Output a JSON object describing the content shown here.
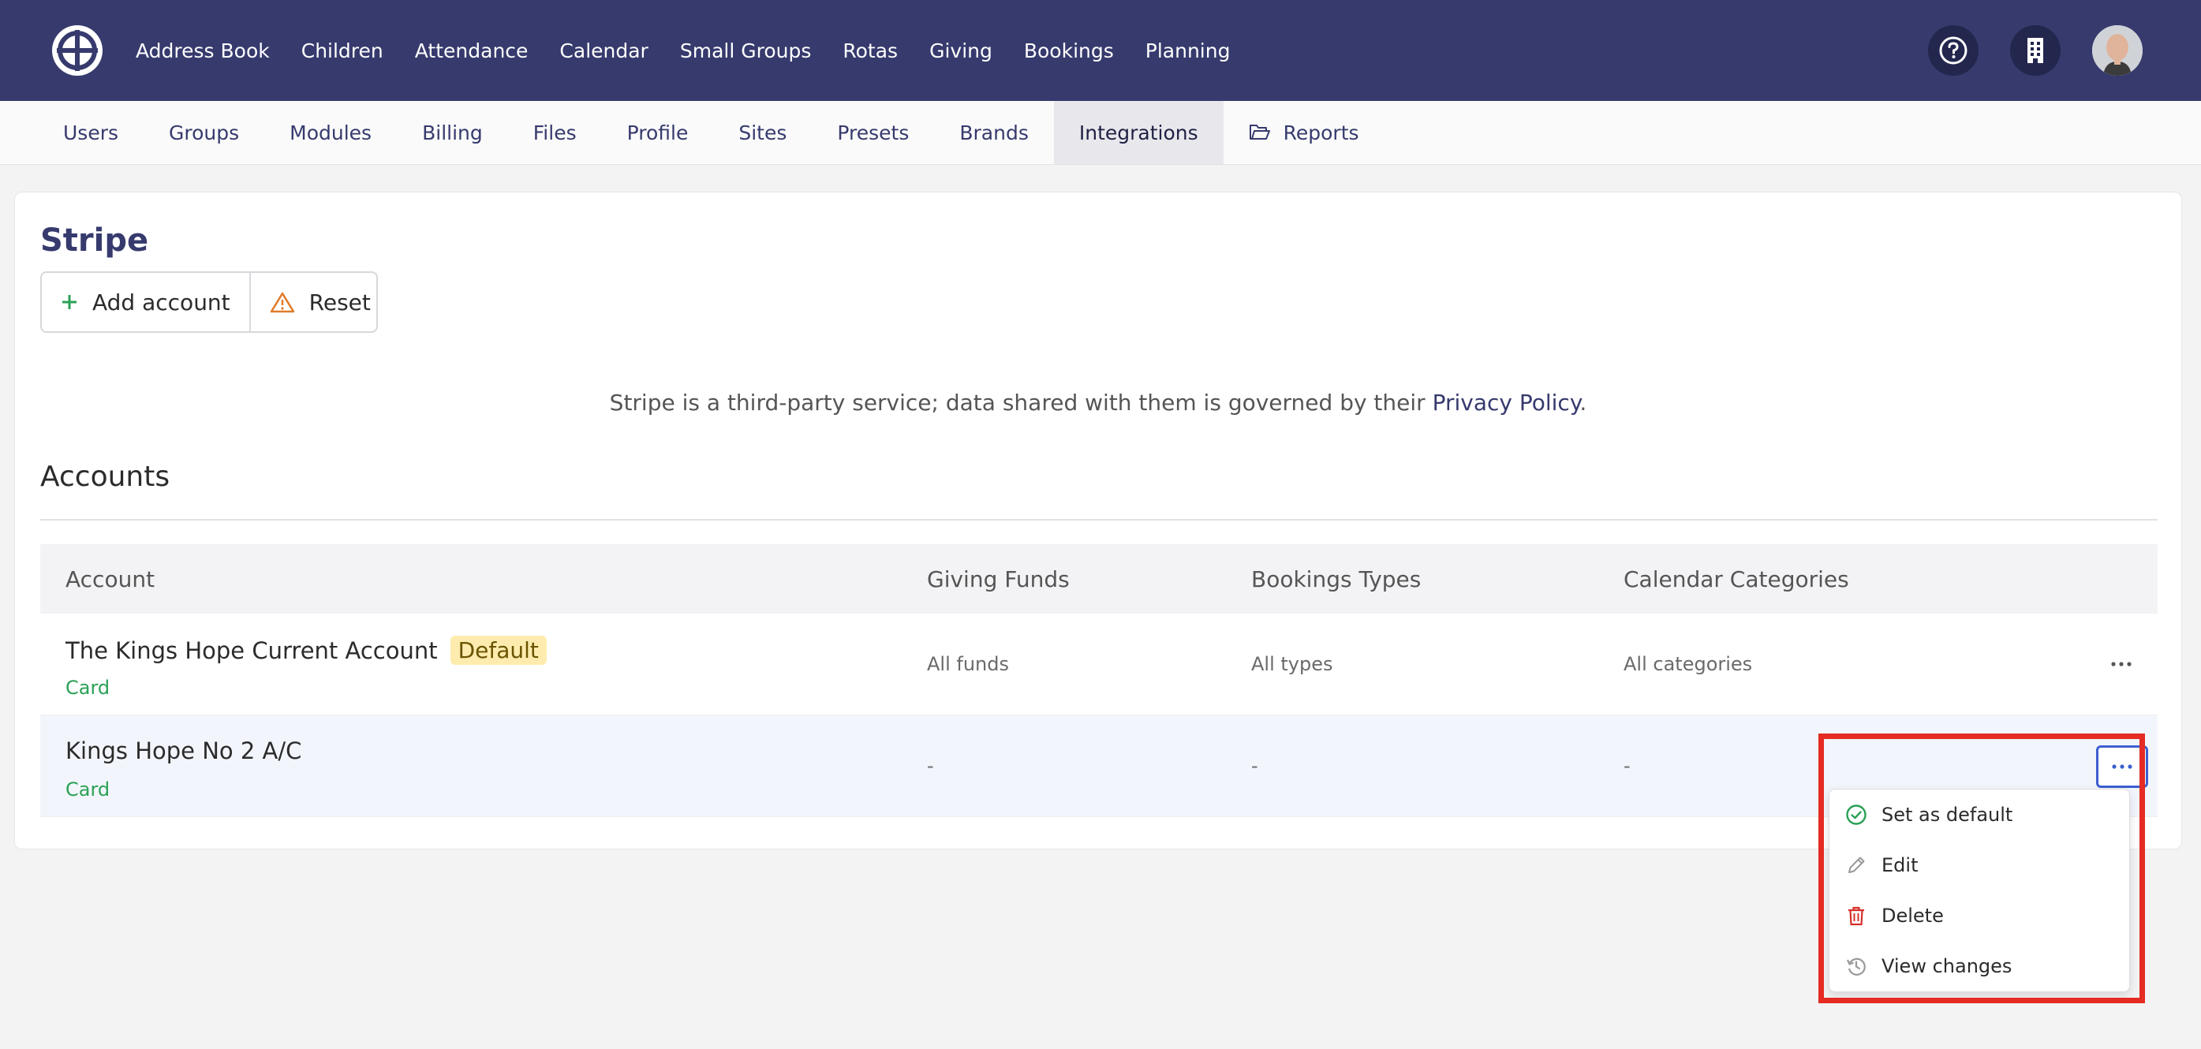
{
  "topnav": {
    "items": [
      "Address Book",
      "Children",
      "Attendance",
      "Calendar",
      "Small Groups",
      "Rotas",
      "Giving",
      "Bookings",
      "Planning"
    ]
  },
  "subnav": {
    "tabs": [
      "Users",
      "Groups",
      "Modules",
      "Billing",
      "Files",
      "Profile",
      "Sites",
      "Presets",
      "Brands",
      "Integrations",
      "Reports"
    ],
    "active": "Integrations"
  },
  "page": {
    "title": "Stripe",
    "add_account_label": "Add account",
    "reset_label": "Reset",
    "notice_prefix": "Stripe is a third-party service; data shared with them is governed by their ",
    "notice_link": "Privacy Policy",
    "notice_suffix": ".",
    "section_title": "Accounts"
  },
  "table": {
    "headers": [
      "Account",
      "Giving Funds",
      "Bookings Types",
      "Calendar Categories"
    ],
    "rows": [
      {
        "name": "The Kings Hope Current Account",
        "badge": "Default",
        "type": "Card",
        "funds": "All funds",
        "types": "All types",
        "categories": "All categories"
      },
      {
        "name": "Kings Hope No 2 A/C",
        "badge": "",
        "type": "Card",
        "funds": "-",
        "types": "-",
        "categories": "-"
      }
    ]
  },
  "menu": {
    "items": [
      "Set as default",
      "Edit",
      "Delete",
      "View changes"
    ]
  },
  "colors": {
    "brand": "#363a6d",
    "success": "#2aa155",
    "danger": "#d6302b",
    "warning": "#e07b2a",
    "annotation": "#e52b23"
  }
}
